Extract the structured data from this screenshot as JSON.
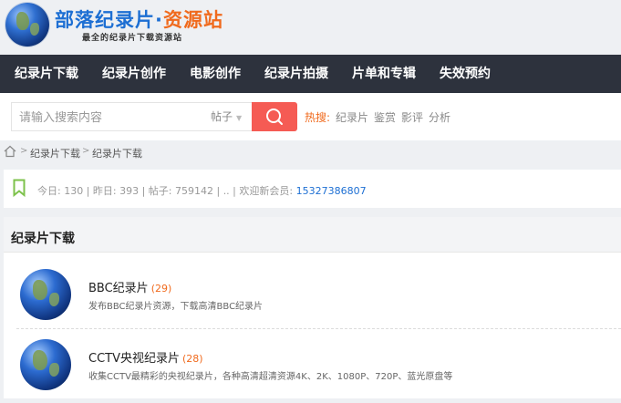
{
  "site": {
    "title_part1": "部落纪录片",
    "title_dot": "·",
    "title_part2": "资源站",
    "subtitle": "最全的纪录片下载资源站"
  },
  "nav": {
    "items": [
      {
        "label": "纪录片下载"
      },
      {
        "label": "纪录片创作"
      },
      {
        "label": "电影创作"
      },
      {
        "label": "纪录片拍摄"
      },
      {
        "label": "片单和专辑"
      },
      {
        "label": "失效预约"
      }
    ]
  },
  "search": {
    "placeholder": "请输入搜索内容",
    "type": "帖子",
    "hot_label": "热搜:",
    "hot_items": [
      "纪录片",
      "鉴赏",
      "影评",
      "分析"
    ]
  },
  "breadcrumb": {
    "items": [
      "纪录片下载",
      "纪录片下载"
    ]
  },
  "stats": {
    "text": "今日: 130 | 昨日: 393 | 帖子: 759142 | .. | 欢迎新会员: ",
    "member": "15327386807"
  },
  "section": {
    "title": "纪录片下载",
    "forums": [
      {
        "name": "BBC纪录片",
        "count": "(29)",
        "desc": "发布BBC纪录片资源，下载高清BBC纪录片"
      },
      {
        "name": "CCTV央视纪录片",
        "count": "(28)",
        "desc": "收集CCTV最精彩的央视纪录片，各种高清超清资源4K、2K、1080P、720P、蓝光原盘等"
      }
    ]
  },
  "colors": {
    "nav_bg": "#2d323d",
    "search_button": "#f55b54",
    "accent_orange": "#f06a1d",
    "accent_blue": "#1d6fd3"
  }
}
